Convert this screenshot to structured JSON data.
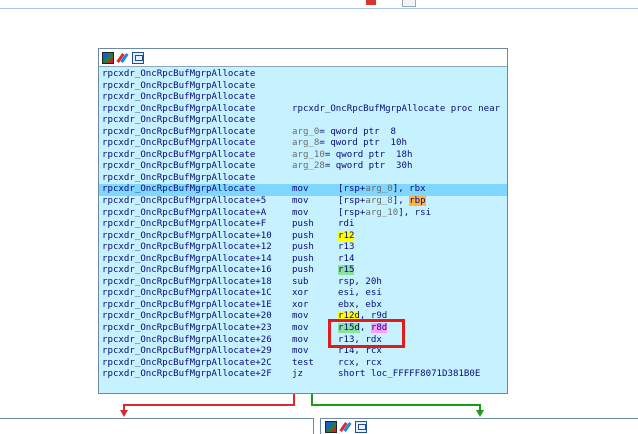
{
  "node": {
    "icons": [
      "color-icon",
      "edit-icon",
      "graph-icon"
    ],
    "lines": [
      {
        "addr": "rpcxdr_OncRpcBufMgrpAllocate",
        "mn": "",
        "ops": []
      },
      {
        "addr": "rpcxdr_OncRpcBufMgrpAllocate",
        "mn": "",
        "ops": []
      },
      {
        "addr": "rpcxdr_OncRpcBufMgrpAllocate",
        "mn": "",
        "ops": []
      },
      {
        "addr": "rpcxdr_OncRpcBufMgrpAllocate",
        "mn": "",
        "ops": [
          {
            "t": "rpcxdr_OncRpcBufMgrpAllocate proc near",
            "c": ""
          }
        ]
      },
      {
        "addr": "rpcxdr_OncRpcBufMgrpAllocate",
        "mn": "",
        "ops": []
      },
      {
        "addr": "rpcxdr_OncRpcBufMgrpAllocate",
        "mn": "",
        "ops": [
          {
            "t": "arg_0",
            "c": "ph"
          },
          {
            "t": "= qword ptr  8",
            "c": ""
          }
        ]
      },
      {
        "addr": "rpcxdr_OncRpcBufMgrpAllocate",
        "mn": "",
        "ops": [
          {
            "t": "arg_8",
            "c": "ph"
          },
          {
            "t": "= qword ptr  10h",
            "c": ""
          }
        ]
      },
      {
        "addr": "rpcxdr_OncRpcBufMgrpAllocate",
        "mn": "",
        "ops": [
          {
            "t": "arg_10",
            "c": "ph"
          },
          {
            "t": "= qword ptr  18h",
            "c": ""
          }
        ]
      },
      {
        "addr": "rpcxdr_OncRpcBufMgrpAllocate",
        "mn": "",
        "ops": [
          {
            "t": "arg_28",
            "c": "ph"
          },
          {
            "t": "= qword ptr  30h",
            "c": ""
          }
        ]
      },
      {
        "addr": "rpcxdr_OncRpcBufMgrpAllocate",
        "mn": "",
        "ops": []
      },
      {
        "addr": "rpcxdr_OncRpcBufMgrpAllocate",
        "mn": "mov",
        "ops": [
          {
            "t": "[rsp+",
            "c": ""
          },
          {
            "t": "arg_0",
            "c": "ph"
          },
          {
            "t": "], rbx",
            "c": ""
          }
        ],
        "selected": true
      },
      {
        "addr": "rpcxdr_OncRpcBufMgrpAllocate+5",
        "mn": "mov",
        "ops": [
          {
            "t": "[rsp+",
            "c": ""
          },
          {
            "t": "arg_8",
            "c": "ph"
          },
          {
            "t": "], ",
            "c": ""
          },
          {
            "t": "rbp",
            "c": "hl-o"
          }
        ]
      },
      {
        "addr": "rpcxdr_OncRpcBufMgrpAllocate+A",
        "mn": "mov",
        "ops": [
          {
            "t": "[rsp+",
            "c": ""
          },
          {
            "t": "arg_10",
            "c": "ph"
          },
          {
            "t": "], rsi",
            "c": ""
          }
        ]
      },
      {
        "addr": "rpcxdr_OncRpcBufMgrpAllocate+F",
        "mn": "push",
        "ops": [
          {
            "t": "rdi",
            "c": ""
          }
        ]
      },
      {
        "addr": "rpcxdr_OncRpcBufMgrpAllocate+10",
        "mn": "push",
        "ops": [
          {
            "t": "r12",
            "c": "hl-y"
          }
        ]
      },
      {
        "addr": "rpcxdr_OncRpcBufMgrpAllocate+12",
        "mn": "push",
        "ops": [
          {
            "t": "r13",
            "c": ""
          }
        ]
      },
      {
        "addr": "rpcxdr_OncRpcBufMgrpAllocate+14",
        "mn": "push",
        "ops": [
          {
            "t": "r14",
            "c": ""
          }
        ]
      },
      {
        "addr": "rpcxdr_OncRpcBufMgrpAllocate+16",
        "mn": "push",
        "ops": [
          {
            "t": "r15",
            "c": "hl-g"
          }
        ]
      },
      {
        "addr": "rpcxdr_OncRpcBufMgrpAllocate+18",
        "mn": "sub",
        "ops": [
          {
            "t": "rsp, 20h",
            "c": ""
          }
        ]
      },
      {
        "addr": "rpcxdr_OncRpcBufMgrpAllocate+1C",
        "mn": "xor",
        "ops": [
          {
            "t": "esi, esi",
            "c": ""
          }
        ]
      },
      {
        "addr": "rpcxdr_OncRpcBufMgrpAllocate+1E",
        "mn": "xor",
        "ops": [
          {
            "t": "ebx, ebx",
            "c": ""
          }
        ]
      },
      {
        "addr": "rpcxdr_OncRpcBufMgrpAllocate+20",
        "mn": "mov",
        "ops": [
          {
            "t": "r12d",
            "c": "hl-y"
          },
          {
            "t": ", r9d",
            "c": ""
          }
        ]
      },
      {
        "addr": "rpcxdr_OncRpcBufMgrpAllocate+23",
        "mn": "mov",
        "ops": [
          {
            "t": "r15d",
            "c": "hl-g"
          },
          {
            "t": ", ",
            "c": ""
          },
          {
            "t": "r8d",
            "c": "hl-p"
          }
        ]
      },
      {
        "addr": "rpcxdr_OncRpcBufMgrpAllocate+26",
        "mn": "mov",
        "ops": [
          {
            "t": "r13, rdx",
            "c": ""
          }
        ]
      },
      {
        "addr": "rpcxdr_OncRpcBufMgrpAllocate+29",
        "mn": "mov",
        "ops": [
          {
            "t": "r14, rcx",
            "c": ""
          }
        ]
      },
      {
        "addr": "rpcxdr_OncRpcBufMgrpAllocate+2C",
        "mn": "test",
        "ops": [
          {
            "t": "rcx, rcx",
            "c": ""
          }
        ]
      },
      {
        "addr": "rpcxdr_OncRpcBufMgrpAllocate+2F",
        "mn": "jz",
        "ops": [
          {
            "t": "short loc_FFFFF8071D381B0E",
            "c": ""
          }
        ]
      }
    ]
  },
  "colors": {
    "node_bg": "#c6f2ff",
    "selected_line": "#7fd6ff",
    "text": "#0a0a7a",
    "placeholder": "#6b6b6b",
    "highlight_yellow": "#ffff00",
    "highlight_green": "#8ce0a0",
    "highlight_pink": "#ff9cff",
    "highlight_orange": "#ffb347",
    "annotation_box": "#e01b1b",
    "edge_false": "#d62e2e",
    "edge_true": "#1a9a1a"
  },
  "next_node": {
    "icons": [
      "color-icon",
      "edit-icon",
      "graph-icon"
    ]
  }
}
